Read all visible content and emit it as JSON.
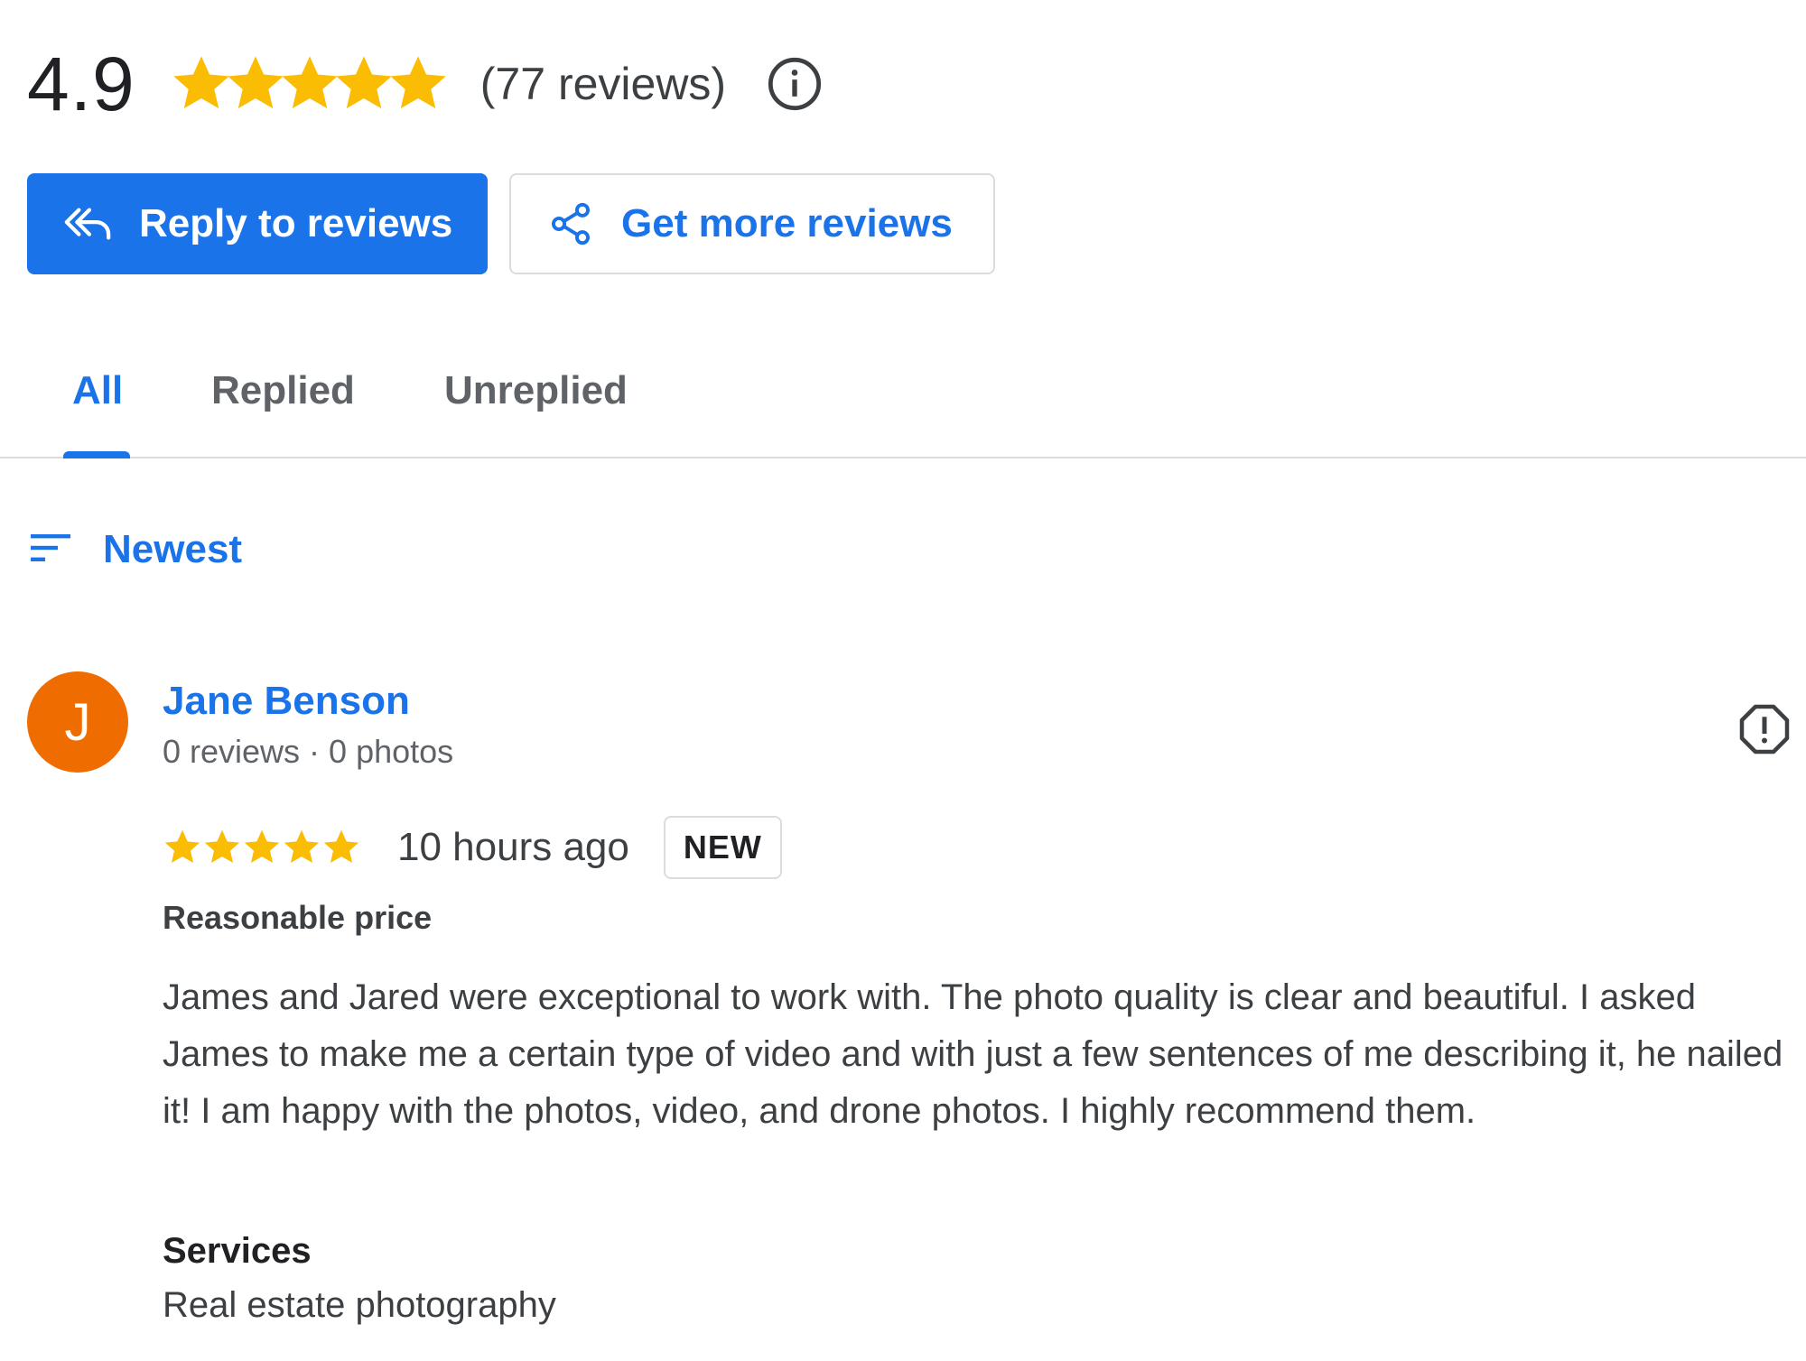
{
  "summary": {
    "rating": "4.9",
    "stars_filled": 5,
    "stars_total": 5,
    "review_count": "(77 reviews)",
    "star_color": "#FBBC04"
  },
  "actions": {
    "reply_label": "Reply to reviews",
    "get_more_label": "Get more reviews",
    "primary_color": "#1a73e8"
  },
  "tabs": [
    {
      "label": "All",
      "active": true
    },
    {
      "label": "Replied",
      "active": false
    },
    {
      "label": "Unreplied",
      "active": false
    }
  ],
  "sort": {
    "label": "Newest",
    "icon": "sort-icon"
  },
  "review": {
    "avatar_letter": "J",
    "avatar_color": "#ef6c00",
    "name": "Jane Benson",
    "meta": "0 reviews · 0 photos",
    "stars": 5,
    "time": "10 hours ago",
    "badge": "NEW",
    "highlight": "Reasonable price",
    "text": "James and Jared were exceptional to work with. The photo quality is clear and beautiful. I asked James to make me a certain type of video and with just a few sentences of me describing it, he nailed it! I am happy with the photos, video, and drone photos. I highly recommend them.",
    "services_label": "Services",
    "services_value": "Real estate photography"
  }
}
